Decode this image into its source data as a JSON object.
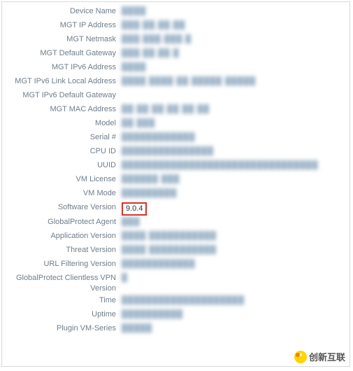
{
  "rows": [
    {
      "label": "Device Name",
      "value": "████",
      "blur": true
    },
    {
      "label": "MGT IP Address",
      "value": "███.██.██.██",
      "blur": true
    },
    {
      "label": "MGT Netmask",
      "value": "███.███.███.█",
      "blur": true
    },
    {
      "label": "MGT Default Gateway",
      "value": "███.██.██.█",
      "blur": true
    },
    {
      "label": "MGT IPv6 Address",
      "value": "████",
      "blur": true
    },
    {
      "label": "MGT IPv6 Link Local Address",
      "value": "████ ████ ██ █████ █████",
      "blur": true
    },
    {
      "label": "MGT IPv6 Default Gateway",
      "value": "",
      "blur": false
    },
    {
      "label": "MGT MAC Address",
      "value": "██ ██ ██ ██ ██ ██",
      "blur": true
    },
    {
      "label": "Model",
      "value": "██ ███",
      "blur": true
    },
    {
      "label": "Serial #",
      "value": "████████████",
      "blur": true
    },
    {
      "label": "CPU ID",
      "value": "███████████████",
      "blur": true
    },
    {
      "label": "UUID",
      "value": "████████████████████████████████",
      "blur": true
    },
    {
      "label": "VM License",
      "value": "██████ ███",
      "blur": true
    },
    {
      "label": "VM Mode",
      "value": "█████████",
      "blur": true
    },
    {
      "label": "Software Version",
      "value": "9.0.4",
      "blur": false,
      "highlight": true
    },
    {
      "label": "GlobalProtect Agent",
      "value": "███",
      "blur": true
    },
    {
      "label": "Application Version",
      "value": "████ ███████████",
      "blur": true
    },
    {
      "label": "Threat Version",
      "value": "████ ███████████",
      "blur": true
    },
    {
      "label": "URL Filtering Version",
      "value": "████████████",
      "blur": true
    },
    {
      "label": "GlobalProtect Clientless VPN Version",
      "value": "█",
      "blur": true
    },
    {
      "label": "Time",
      "value": "████████████████████",
      "blur": true
    },
    {
      "label": "Uptime",
      "value": "██████████",
      "blur": true
    },
    {
      "label": "Plugin VM-Series",
      "value": "█████",
      "blur": true
    }
  ],
  "watermark": {
    "text": "创新互联"
  }
}
